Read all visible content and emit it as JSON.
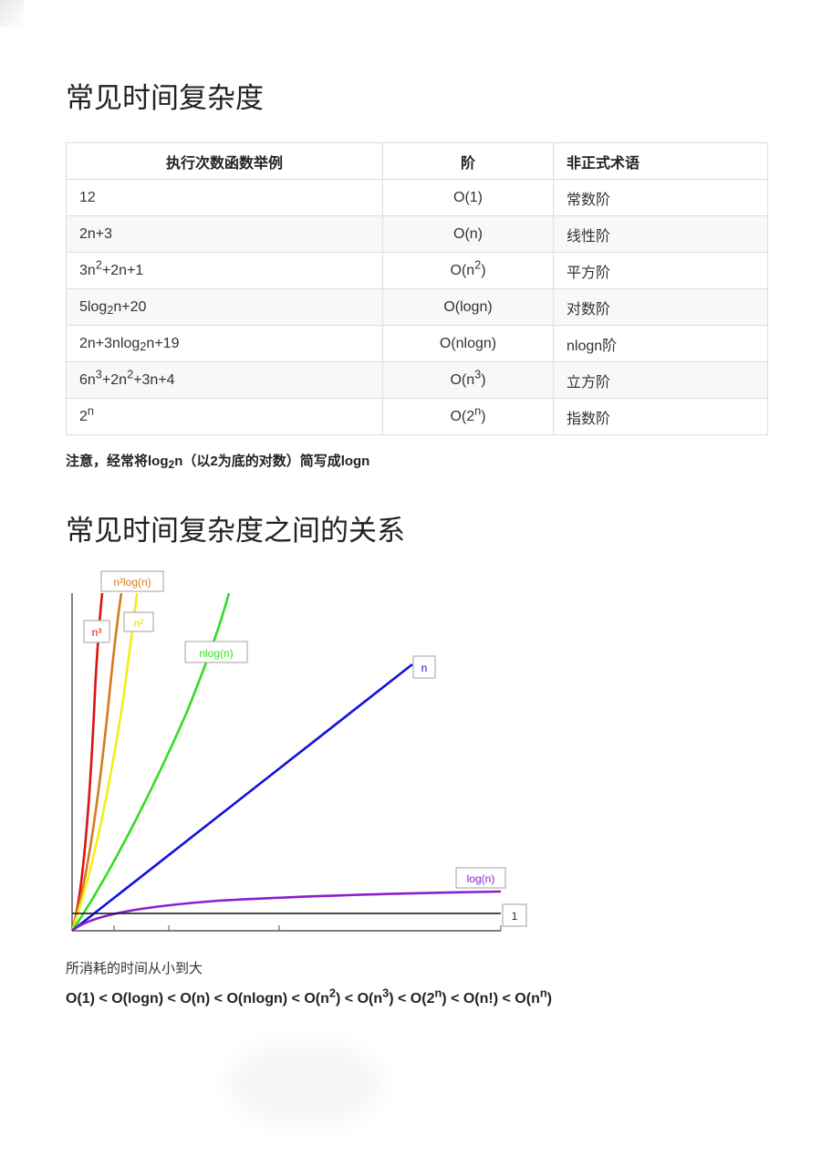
{
  "section1": {
    "title": "常见时间复杂度"
  },
  "table": {
    "headers": [
      "执行次数函数举例",
      "阶",
      "非正式术语"
    ],
    "rows": [
      {
        "example": [
          "12"
        ],
        "order": [
          "O(1)"
        ],
        "term": "常数阶"
      },
      {
        "example": [
          "2n+3"
        ],
        "order": [
          "O(n)"
        ],
        "term": "线性阶"
      },
      {
        "example": [
          "3n",
          "2",
          "+2n+1"
        ],
        "order": [
          "O(n",
          "2",
          ")"
        ],
        "term": "平方阶"
      },
      {
        "example": [
          "5log",
          "2",
          "n+20"
        ],
        "order": [
          "O(logn)"
        ],
        "term": "对数阶"
      },
      {
        "example": [
          "2n+3nlog",
          "2",
          "n+19"
        ],
        "order": [
          "O(nlogn)"
        ],
        "term": "nlogn阶"
      },
      {
        "example": [
          "6n",
          "3",
          "+2n",
          "2",
          "+3n+4"
        ],
        "order": [
          "O(n",
          "3",
          ")"
        ],
        "term": "立方阶"
      },
      {
        "example": [
          "2",
          "n"
        ],
        "order": [
          "O(2",
          "n",
          ")"
        ],
        "term": "指数阶"
      }
    ]
  },
  "note": {
    "prefix": "注意，经常将log",
    "sub": "2",
    "suffix": "n（以2为底的对数）简写成logn"
  },
  "section2": {
    "title": "常见时间复杂度之间的关系"
  },
  "chart_data": {
    "type": "line",
    "title": "",
    "xlabel": "",
    "ylabel": "",
    "grid": false,
    "series": [
      {
        "name": "n³",
        "function": "n^3",
        "color": "#dd1111"
      },
      {
        "name": "n²log(n)",
        "function": "n^2*log(n)",
        "color": "#d77a1e"
      },
      {
        "name": "n²",
        "function": "n^2",
        "color": "#f2ef18"
      },
      {
        "name": "nlog(n)",
        "function": "n*log(n)",
        "color": "#33dd22"
      },
      {
        "name": "n",
        "function": "n",
        "color": "#1111dd"
      },
      {
        "name": "log(n)",
        "function": "log(n)",
        "color": "#8a1ed0"
      },
      {
        "name": "1",
        "function": "1",
        "color": "#111111"
      }
    ]
  },
  "caption": "所消耗的时间从小到大",
  "ordering": [
    {
      "t": "O(1) < O(logn) < O(n) < O(nlogn) < O(n"
    },
    {
      "t": "2",
      "sup": true
    },
    {
      "t": ") < O(n"
    },
    {
      "t": "3",
      "sup": true
    },
    {
      "t": ") < O(2"
    },
    {
      "t": "n",
      "sup": true
    },
    {
      "t": ") < O(n!) < O(n"
    },
    {
      "t": "n",
      "sup": true
    },
    {
      "t": ")"
    }
  ]
}
